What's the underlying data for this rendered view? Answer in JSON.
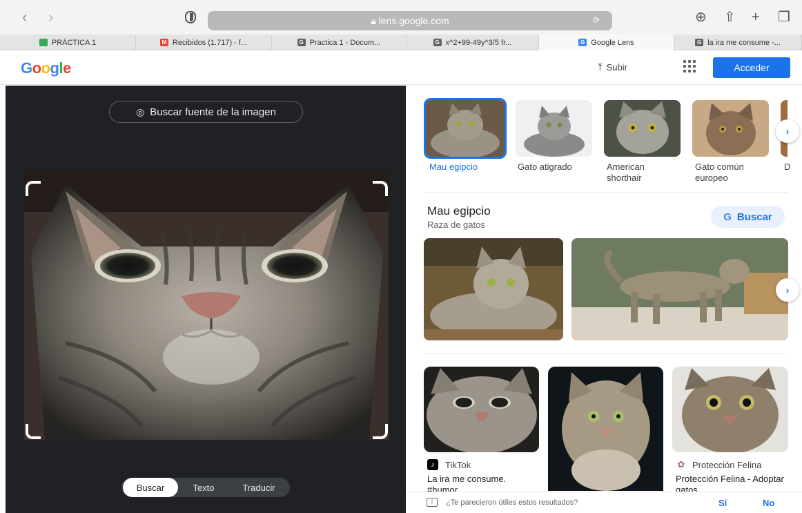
{
  "browser": {
    "url": "lens.google.com",
    "tabs": [
      {
        "label": "PRÁCTICA 1",
        "color": "#34a853",
        "glyph": ""
      },
      {
        "label": "Recibidos (1.717) - f...",
        "color": "#ea4335",
        "glyph": "M"
      },
      {
        "label": "Practica 1 - Docum...",
        "color": "#5f6368",
        "glyph": "G"
      },
      {
        "label": "x^2+99-49y^3/5 fr...",
        "color": "#5f6368",
        "glyph": "G"
      },
      {
        "label": "Google Lens",
        "color": "#4285f4",
        "glyph": "G"
      },
      {
        "label": "la ira me consume -...",
        "color": "#5f6368",
        "glyph": "G"
      }
    ]
  },
  "header": {
    "logo": "Google",
    "upload_label": "Subir",
    "signin_label": "Acceder"
  },
  "lens": {
    "source_button": "Buscar fuente de la imagen",
    "modes": [
      "Buscar",
      "Texto",
      "Traducir"
    ],
    "selected_mode": "Buscar"
  },
  "results": {
    "chips": [
      {
        "label": "Mau egipcio",
        "selected": true
      },
      {
        "label": "Gato atigrado",
        "selected": false
      },
      {
        "label": "American shorthair",
        "selected": false
      },
      {
        "label": "Gato común europeo",
        "selected": false
      },
      {
        "label": "D",
        "selected": false
      }
    ],
    "knowledge": {
      "title": "Mau egipcio",
      "subtitle": "Raza de gatos",
      "search_label": "Buscar"
    },
    "cards": [
      {
        "source": "TikTok",
        "title": "La ira me consume. #humor"
      },
      {
        "source": "",
        "title": ""
      },
      {
        "source": "Protección Felina",
        "title": "Protección Felina - Adoptar gatos"
      }
    ],
    "feedback": {
      "question": "¿Te parecieron útiles estos resultados?",
      "yes": "Sí",
      "no": "No"
    }
  },
  "colors": {
    "accent": "#1a73e8",
    "panel_dark": "#202124"
  }
}
